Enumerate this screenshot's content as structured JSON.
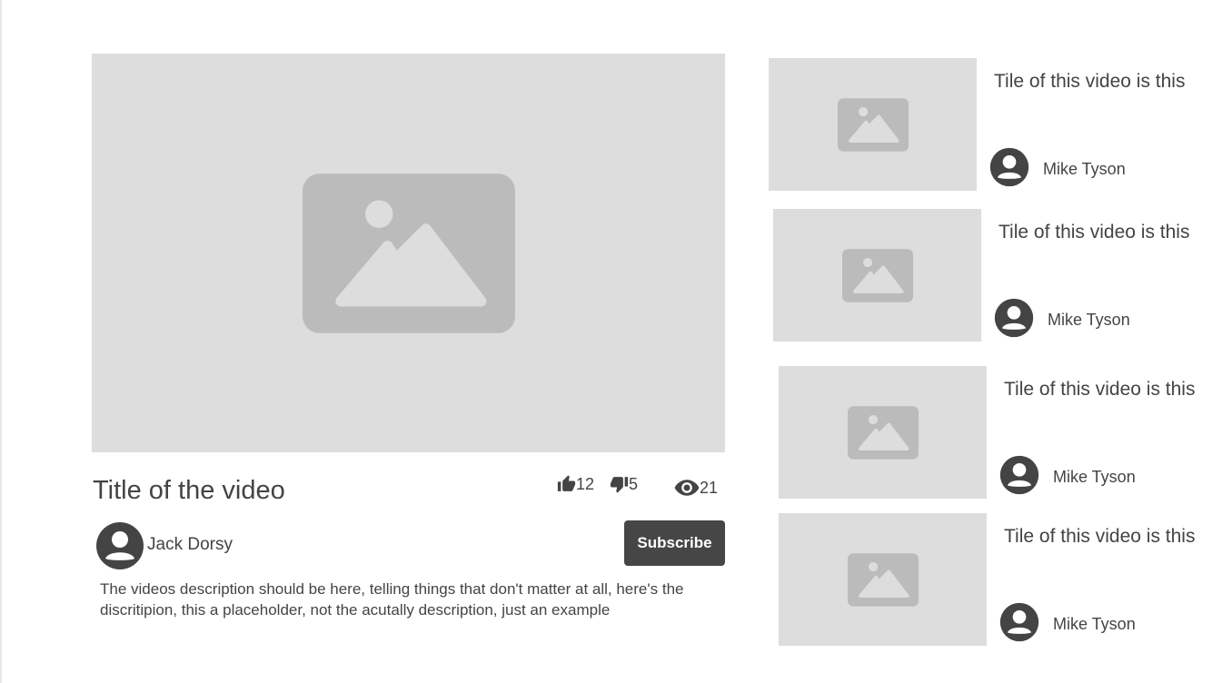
{
  "main": {
    "title": "Title of the video",
    "likes": "12",
    "dislikes": "5",
    "views": "21",
    "channel": "Jack Dorsy",
    "subscribe_label": "Subscribe",
    "description": "The videos description should be here, telling things that don't matter at all, here's the discritipion, this a placeholder, not the acutally description, just an example"
  },
  "recommendations": [
    {
      "title": "Tile of this video is this",
      "channel": "Mike Tyson"
    },
    {
      "title": "Tile of this video is this",
      "channel": "Mike Tyson"
    },
    {
      "title": "Tile of this video is this",
      "channel": "Mike Tyson"
    },
    {
      "title": "Tile of this video is this",
      "channel": "Mike Tyson"
    }
  ],
  "icons": {
    "player": "image-placeholder-icon",
    "likes": "thumbs-up-icon",
    "dislikes": "thumbs-down-icon",
    "views": "eye-icon",
    "avatar": "user-avatar-icon"
  },
  "colors": {
    "placeholder_bg": "#dddddd",
    "placeholder_icon": "#bbbbbb",
    "text": "#444444",
    "button_bg": "#464646",
    "button_text": "#ffffff"
  }
}
